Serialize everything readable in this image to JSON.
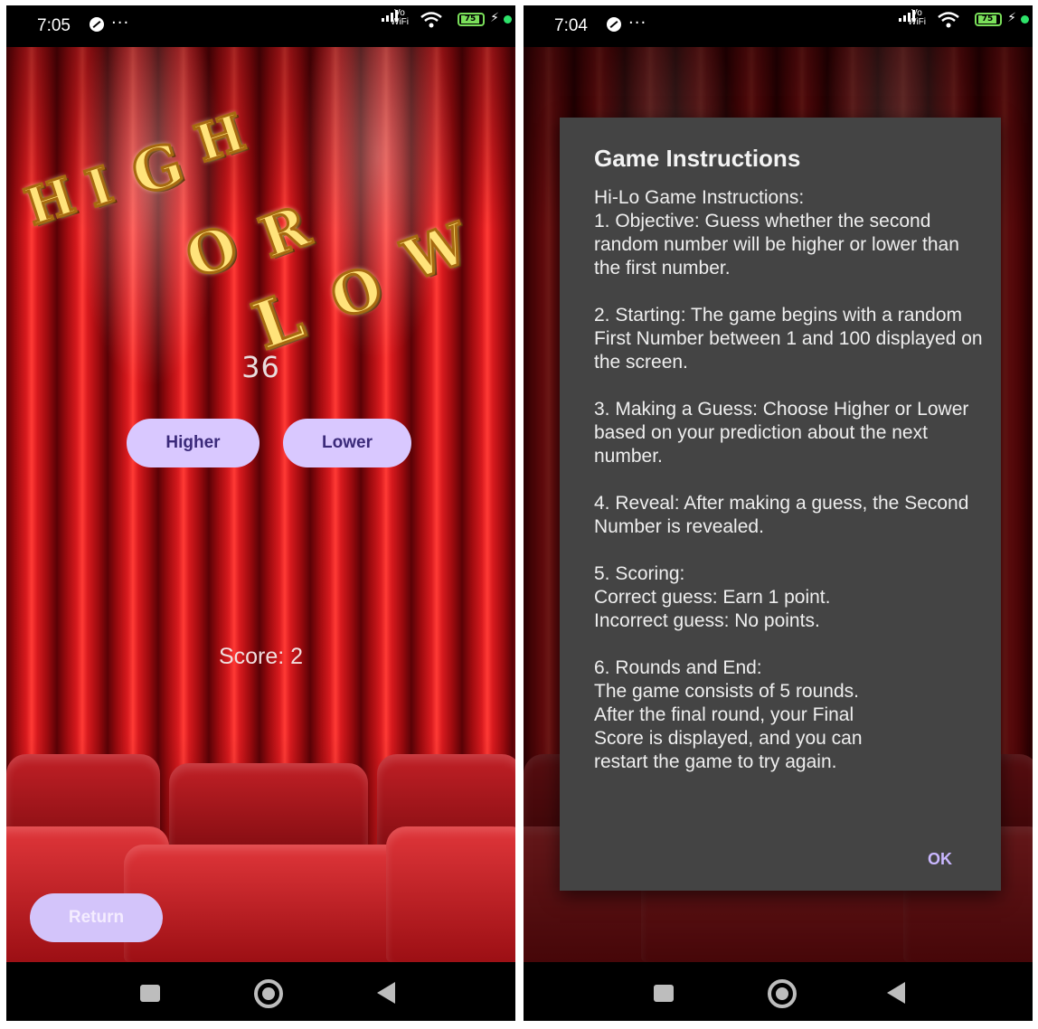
{
  "left_screen": {
    "status": {
      "time": "7:05",
      "dots": "···",
      "vowifi_top": "Vo",
      "vowifi_bottom": "WiFi",
      "battery": "75"
    },
    "title_letters": [
      "H",
      "I",
      "G",
      "H",
      "O",
      "R",
      "L",
      "O",
      "W"
    ],
    "number": "36",
    "higher_label": "Higher",
    "lower_label": "Lower",
    "score": "Score: 2",
    "return_label": "Return"
  },
  "right_screen": {
    "status": {
      "time": "7:04",
      "dots": "···",
      "vowifi_top": "Vo",
      "vowifi_bottom": "WiFi",
      "battery": "75"
    },
    "dialog": {
      "title": "Game Instructions",
      "paragraphs": [
        "Hi-Lo Game Instructions:\n1. Objective: Guess whether the second random number will be higher or lower than the first number.",
        "2. Starting: The game begins with a random First Number between 1 and 100 displayed on the screen.",
        "3. Making a Guess: Choose Higher or Lower based on your prediction about the next number.",
        "4. Reveal: After making a guess, the Second Number is revealed.",
        "5. Scoring:\n    Correct guess: Earn 1 point.\n    Incorrect guess: No points.",
        "6. Rounds and End:\n    The game consists of 5 rounds.\n    After the final round, your Final\n    Score is displayed, and you can\n    restart the game to try again."
      ],
      "ok_label": "OK"
    }
  },
  "colors": {
    "button_bg": "#d9c8ff",
    "button_text": "#3b2a7a",
    "dialog_bg": "#444444",
    "ok_text": "#c9b7ff"
  }
}
